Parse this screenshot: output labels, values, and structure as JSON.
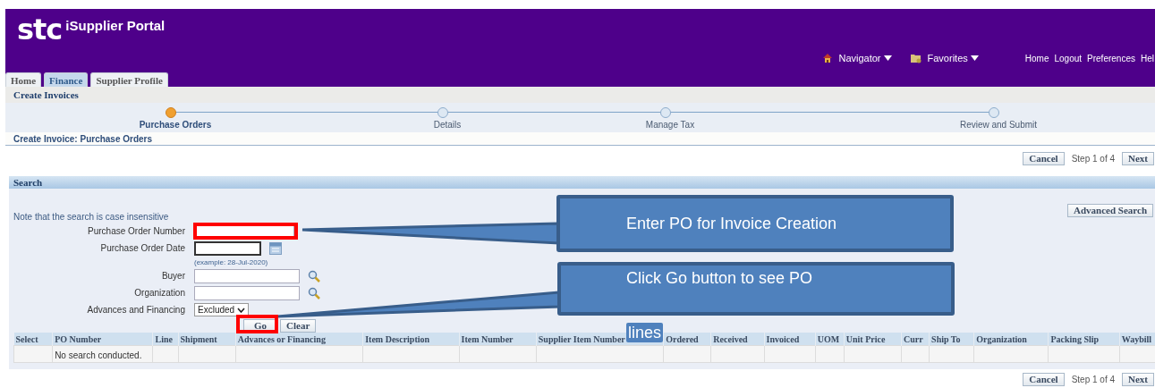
{
  "header": {
    "logo": "stc",
    "title": "iSupplier Portal",
    "navigator": "Navigator",
    "favorites": "Favorites",
    "links": [
      "Home",
      "Logout",
      "Preferences",
      "Hel"
    ]
  },
  "tabs": [
    {
      "label": "Home",
      "selected": false
    },
    {
      "label": "Finance",
      "selected": true
    },
    {
      "label": "Supplier Profile",
      "selected": false
    }
  ],
  "page_title": "Create Invoices",
  "train": [
    {
      "label": "Purchase Orders",
      "selected": true
    },
    {
      "label": "Details",
      "selected": false
    },
    {
      "label": "Manage Tax",
      "selected": false
    },
    {
      "label": "Review and Submit",
      "selected": false
    }
  ],
  "subtitle": "Create Invoice: Purchase Orders",
  "nav_top": {
    "cancel": "Cancel",
    "step": "Step 1 of 4",
    "next": "Next"
  },
  "search": {
    "title": "Search",
    "note": "Note that the search is case insensitive",
    "advanced": "Advanced Search",
    "fields": [
      {
        "kind": "text",
        "label": "Purchase Order Number"
      },
      {
        "kind": "date",
        "label": "Purchase Order Date",
        "hint": "(example: 28-Jul-2020)"
      },
      {
        "kind": "lov",
        "label": "Buyer"
      },
      {
        "kind": "lov",
        "label": "Organization"
      },
      {
        "kind": "select",
        "label": "Advances and Financing",
        "value": "Excluded"
      }
    ],
    "go": "Go",
    "clear": "Clear"
  },
  "table": {
    "columns": [
      "Select",
      "PO Number",
      "Line",
      "Shipment",
      "Advances or Financing",
      "Item Description",
      "Item Number",
      "Supplier Item Number",
      "Ordered",
      "Received",
      "Invoiced",
      "UOM",
      "Unit Price",
      "Curr",
      "Ship To",
      "Organization",
      "Packing Slip",
      "Waybill"
    ],
    "empty": "No search conducted."
  },
  "nav_bottom": {
    "cancel": "Cancel",
    "step": "Step 1 of 4",
    "next": "Next"
  },
  "callouts": [
    {
      "lines": [
        "Enter PO for Invoice Creation"
      ]
    },
    {
      "lines": [
        "Click Go button to see PO",
        "lines"
      ]
    }
  ]
}
